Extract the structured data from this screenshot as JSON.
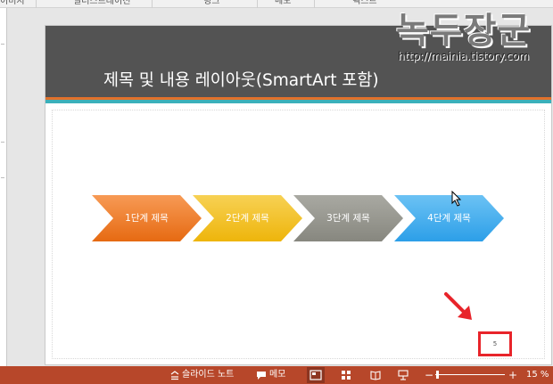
{
  "ribbon": {
    "groups": [
      "이미지",
      "일러스트레이션",
      "링크",
      "메모",
      "텍스트"
    ]
  },
  "slide": {
    "title": "제목 및 내용 레이아웃(SmartArt 포함)",
    "page_number": "5",
    "smartart": [
      {
        "label": "1단계 제목",
        "color": "#ee7421"
      },
      {
        "label": "2단계 제목",
        "color": "#f2bc14"
      },
      {
        "label": "3단계 제목",
        "color": "#8f8f88"
      },
      {
        "label": "4단계 제목",
        "color": "#3aa8ec"
      }
    ]
  },
  "watermark": {
    "title": "녹두장군",
    "url": "http://mainia.tistory.com"
  },
  "status_bar": {
    "notes_label": "슬라이드 노트",
    "comments_label": "메모",
    "zoom": "15 %",
    "zoom_level": 0.15,
    "zoom_out_icon": "minus-icon",
    "zoom_in_icon": "plus-icon",
    "accent_color": "#b7472a"
  },
  "colors": {
    "title_band": "#535353",
    "accent_orange": "#e2712b",
    "accent_teal": "#3bb0ba",
    "highlight_red": "#e8242a"
  }
}
